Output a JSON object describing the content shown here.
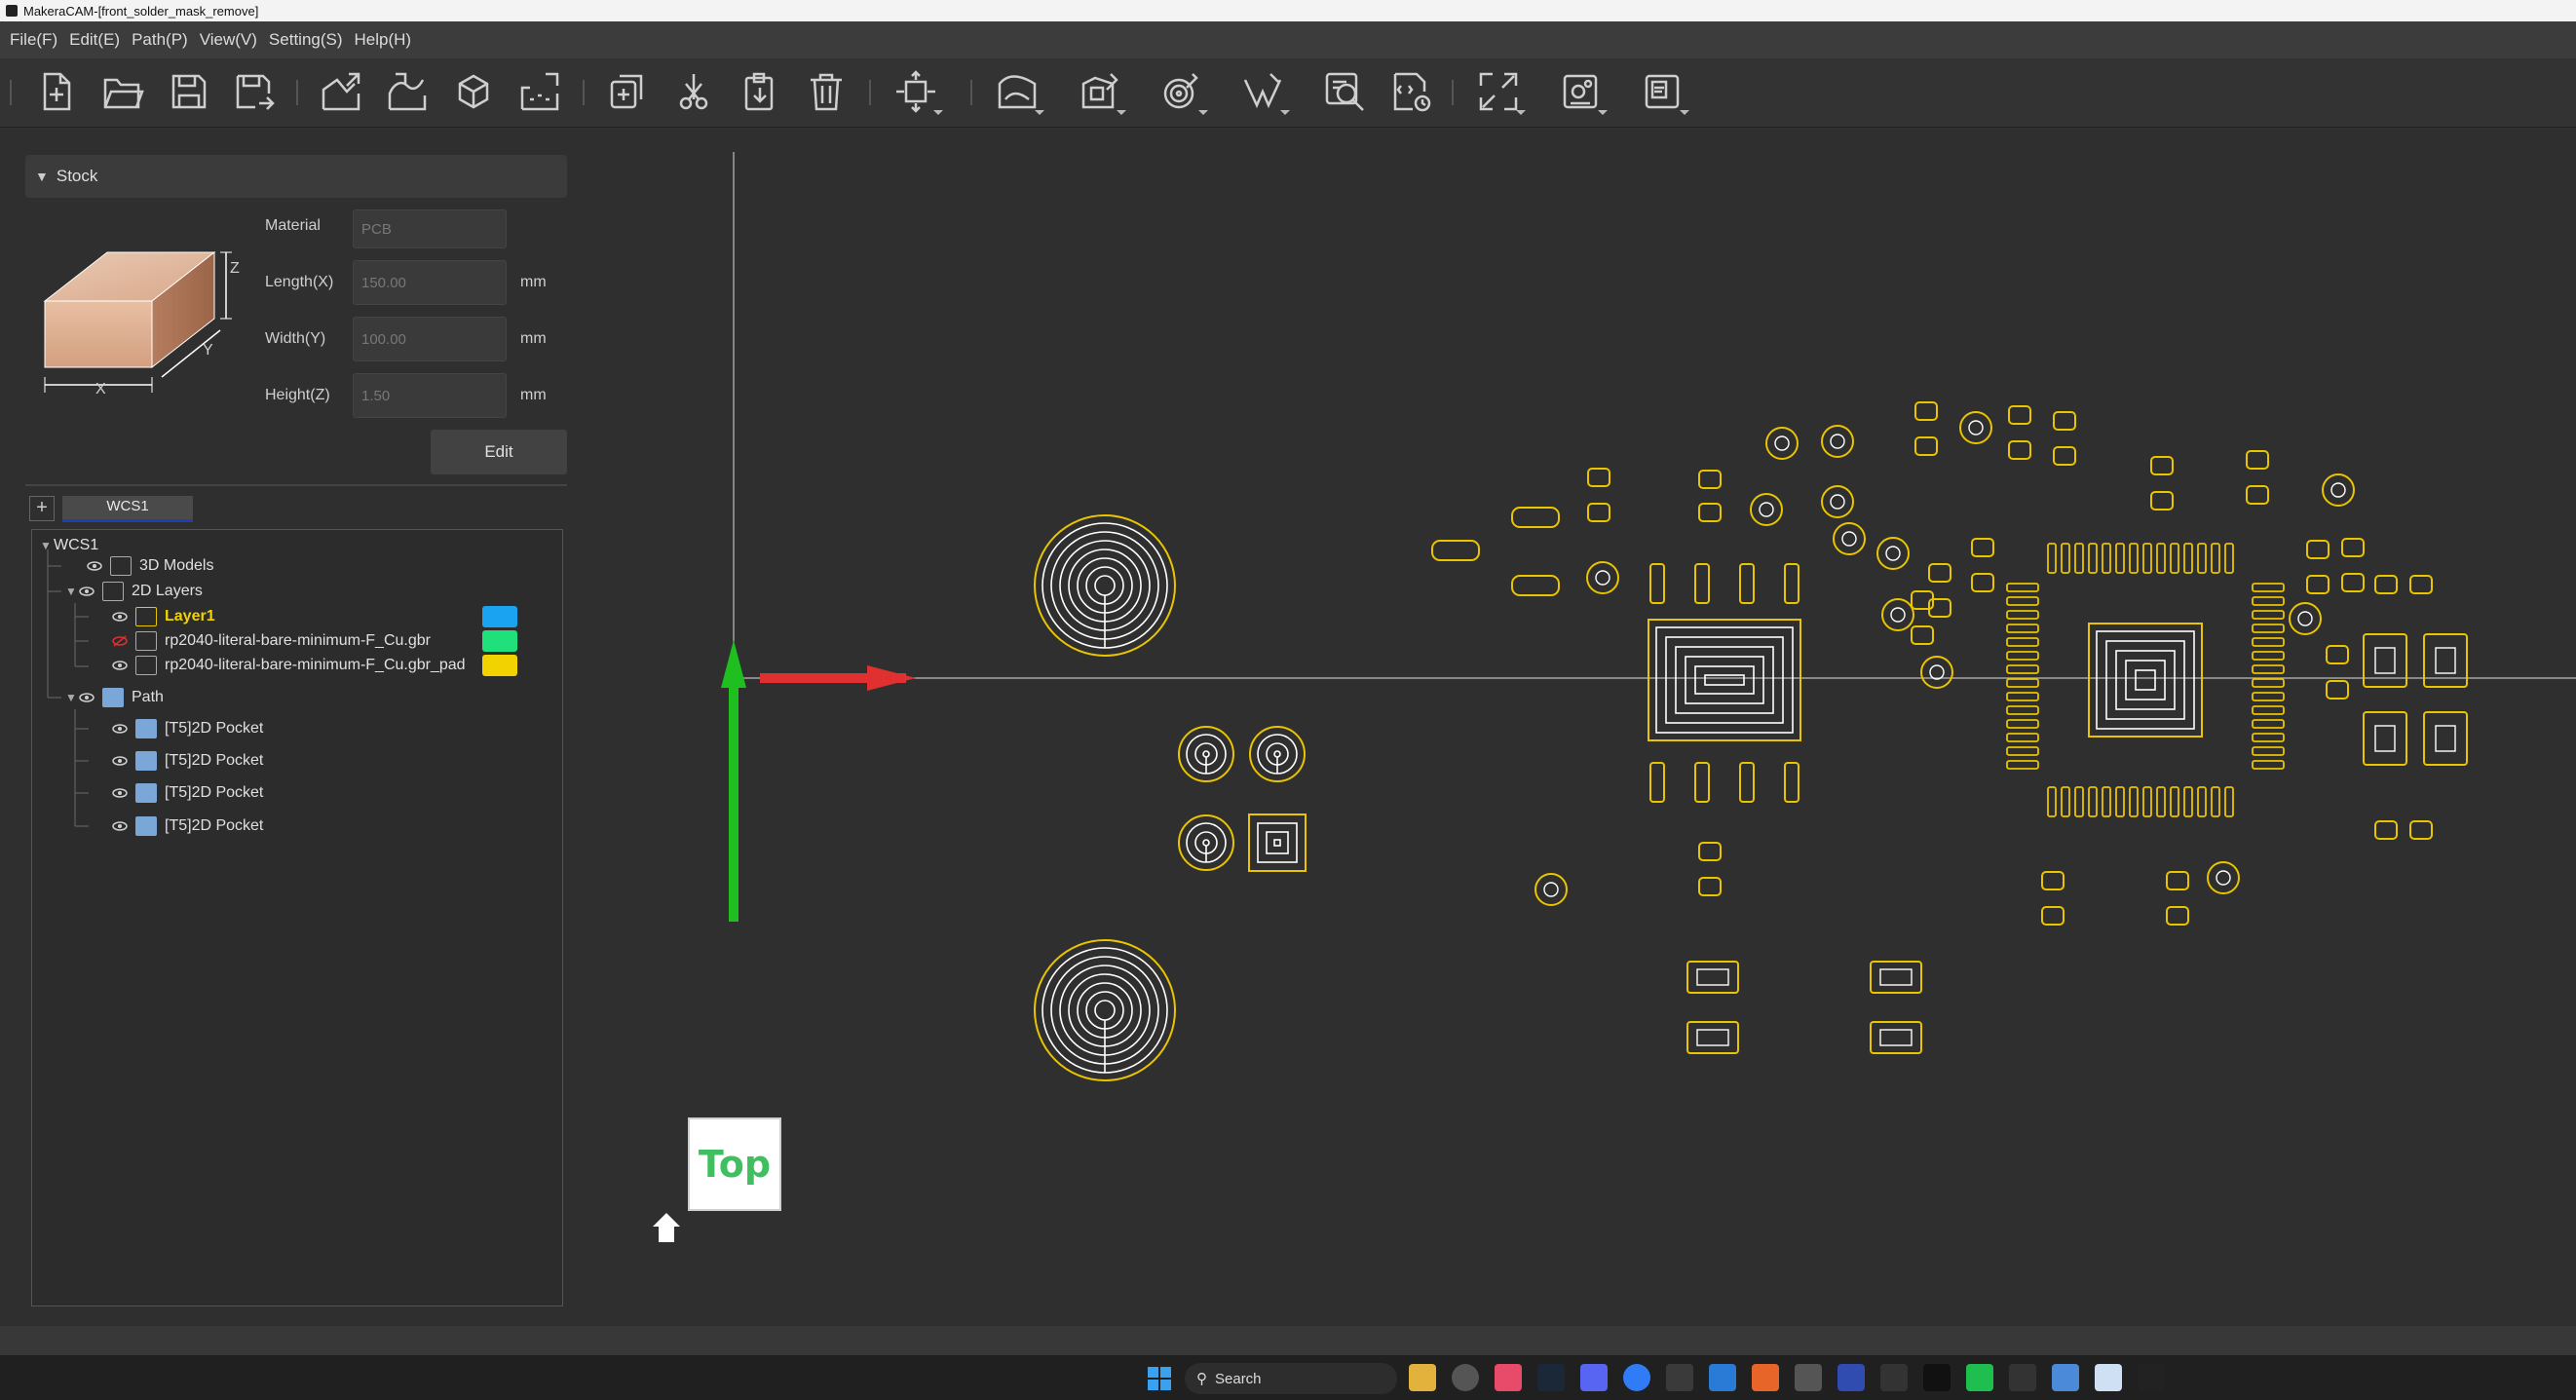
{
  "window": {
    "title": "MakeraCAM-[front_solder_mask_remove]"
  },
  "menu": [
    "File(F)",
    "Edit(E)",
    "Path(P)",
    "View(V)",
    "Setting(S)",
    "Help(H)"
  ],
  "toolbar": {
    "icons": [
      "new-file-icon",
      "open-folder-icon",
      "save-icon",
      "save-as-icon",
      "import-2d-icon",
      "import-curve-icon",
      "import-3d-icon",
      "import-data-icon",
      "copy-path-icon",
      "cut-path-icon",
      "clipboard-icon",
      "delete-icon",
      "transform-icon",
      "curve-toolpath-icon",
      "pocket-toolpath-icon",
      "drill-toolpath-icon",
      "vcarve-toolpath-icon",
      "simulate-icon",
      "gcode-icon",
      "fit-view-icon",
      "machine-icon",
      "report-icon"
    ]
  },
  "stock": {
    "header": "Stock",
    "axis_labels": {
      "x": "X",
      "y": "Y",
      "z": "Z"
    },
    "material_label": "Material",
    "material_value": "PCB",
    "length_label": "Length(X)",
    "length_value": "150.00",
    "width_label": "Width(Y)",
    "width_value": "100.00",
    "height_label": "Height(Z)",
    "height_value": "1.50",
    "unit": "mm",
    "edit_label": "Edit"
  },
  "wcs": {
    "add_label": "+",
    "tab_label": "WCS1",
    "tree": {
      "root": "WCS1",
      "models": "3D Models",
      "layers": "2D Layers",
      "layer_items": [
        {
          "label": "Layer1",
          "color": "#1aa3f0",
          "active": true
        },
        {
          "label": "rp2040-literal-bare-minimum-F_Cu.gbr",
          "color": "#1fe07a",
          "hidden": true
        },
        {
          "label": "rp2040-literal-bare-minimum-F_Cu.gbr_pad",
          "color": "#f2d200"
        }
      ],
      "path": "Path",
      "path_items": [
        "[T5]2D Pocket",
        "[T5]2D Pocket",
        "[T5]2D Pocket",
        "[T5]2D Pocket"
      ]
    }
  },
  "viewport": {
    "view_label": "Top",
    "colors": {
      "pad_outline": "#e9c400",
      "x_axis": "#e03030",
      "y_axis": "#1fbf1f",
      "view_text": "#3fbf5f"
    }
  },
  "taskbar": {
    "search_label": "Search"
  }
}
